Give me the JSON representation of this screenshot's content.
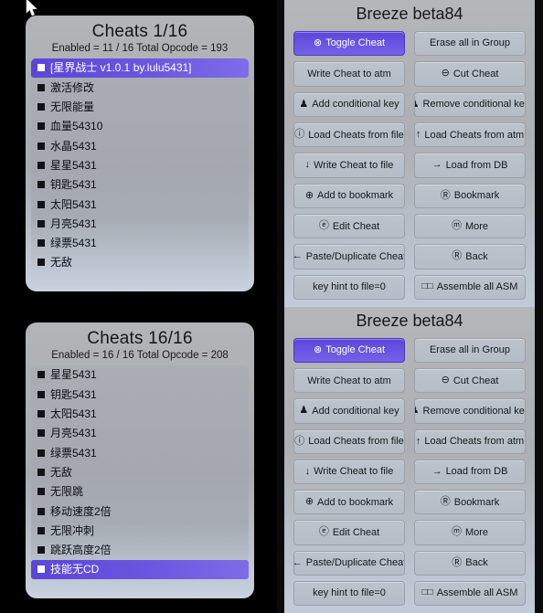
{
  "panels": {
    "top_left": {
      "title": "Cheats 1/16",
      "subtitle": "Enabled = 11 / 16  Total Opcode = 193",
      "items": [
        {
          "label": "[星界战士 v1.0.1 by.lulu5431]",
          "selected": true
        },
        {
          "label": "激活修改",
          "selected": false
        },
        {
          "label": "无限能量",
          "selected": false
        },
        {
          "label": "血量54310",
          "selected": false
        },
        {
          "label": "水晶5431",
          "selected": false
        },
        {
          "label": "星星5431",
          "selected": false
        },
        {
          "label": "钥匙5431",
          "selected": false
        },
        {
          "label": "太阳5431",
          "selected": false
        },
        {
          "label": "月亮5431",
          "selected": false
        },
        {
          "label": "绿票5431",
          "selected": false
        },
        {
          "label": "无敌",
          "selected": false
        }
      ]
    },
    "bottom_left": {
      "title": "Cheats 16/16",
      "subtitle": "Enabled = 16 / 16  Total Opcode = 208",
      "items": [
        {
          "label": "星星5431",
          "selected": false
        },
        {
          "label": "钥匙5431",
          "selected": false
        },
        {
          "label": "太阳5431",
          "selected": false
        },
        {
          "label": "月亮5431",
          "selected": false
        },
        {
          "label": "绿票5431",
          "selected": false
        },
        {
          "label": "无敌",
          "selected": false
        },
        {
          "label": "无限跳",
          "selected": false
        },
        {
          "label": "移动速度2倍",
          "selected": false
        },
        {
          "label": "无限冲刺",
          "selected": false
        },
        {
          "label": "跳跃高度2倍",
          "selected": false
        },
        {
          "label": "技能无CD",
          "selected": true
        }
      ]
    },
    "top_right": {
      "title": "Breeze beta84",
      "buttons": [
        {
          "glyph": "⊗",
          "label": "Toggle Cheat",
          "active": true
        },
        {
          "glyph": "",
          "label": "Erase all in Group",
          "active": false
        },
        {
          "glyph": "",
          "label": "Write Cheat to atm",
          "active": false
        },
        {
          "glyph": "⊖",
          "label": "Cut Cheat",
          "active": false
        },
        {
          "glyph": "♟",
          "label": "Add conditional key",
          "active": false
        },
        {
          "glyph": "♟",
          "label": "Remove conditional key",
          "active": false
        },
        {
          "glyph": "ⓘ",
          "label": "Load Cheats from file",
          "active": false
        },
        {
          "glyph": "↑",
          "label": "Load Cheats from atm",
          "active": false
        },
        {
          "glyph": "↓",
          "label": "Write Cheat to file",
          "active": false
        },
        {
          "glyph": "→",
          "label": "Load from DB",
          "active": false
        },
        {
          "glyph": "⊕",
          "label": "Add to bookmark",
          "active": false
        },
        {
          "glyph": "Ⓡ",
          "label": "Bookmark",
          "active": false
        },
        {
          "glyph": "ⓔ",
          "label": "Edit Cheat",
          "active": false
        },
        {
          "glyph": "ⓜ",
          "label": "More",
          "active": false
        },
        {
          "glyph": "←",
          "label": "Paste/Duplicate Cheat",
          "active": false
        },
        {
          "glyph": "Ⓡ",
          "label": "Back",
          "active": false
        },
        {
          "glyph": "",
          "label": "key hint to file=0",
          "active": false
        },
        {
          "glyph": "□□",
          "label": "Assemble all ASM",
          "active": false
        }
      ]
    },
    "bottom_right": {
      "title": "Breeze beta84",
      "buttons": [
        {
          "glyph": "⊗",
          "label": "Toggle Cheat",
          "active": true
        },
        {
          "glyph": "",
          "label": "Erase all in Group",
          "active": false
        },
        {
          "glyph": "",
          "label": "Write Cheat to atm",
          "active": false
        },
        {
          "glyph": "⊖",
          "label": "Cut Cheat",
          "active": false
        },
        {
          "glyph": "♟",
          "label": "Add conditional key",
          "active": false
        },
        {
          "glyph": "♟",
          "label": "Remove conditional key",
          "active": false
        },
        {
          "glyph": "ⓘ",
          "label": "Load Cheats from file",
          "active": false
        },
        {
          "glyph": "↑",
          "label": "Load Cheats from atm",
          "active": false
        },
        {
          "glyph": "↓",
          "label": "Write Cheat to file",
          "active": false
        },
        {
          "glyph": "→",
          "label": "Load from DB",
          "active": false
        },
        {
          "glyph": "⊕",
          "label": "Add to bookmark",
          "active": false
        },
        {
          "glyph": "Ⓡ",
          "label": "Bookmark",
          "active": false
        },
        {
          "glyph": "ⓔ",
          "label": "Edit Cheat",
          "active": false
        },
        {
          "glyph": "ⓜ",
          "label": "More",
          "active": false
        },
        {
          "glyph": "←",
          "label": "Paste/Duplicate Cheat",
          "active": false
        },
        {
          "glyph": "Ⓡ",
          "label": "Back",
          "active": false
        },
        {
          "glyph": "",
          "label": "key hint to file=0",
          "active": false
        },
        {
          "glyph": "□□",
          "label": "Assemble all ASM",
          "active": false
        }
      ]
    }
  },
  "colors": {
    "accent": "#6a57e2",
    "panel": "#b2b4b8",
    "button": "#bcc3cc",
    "background": "#000000"
  }
}
